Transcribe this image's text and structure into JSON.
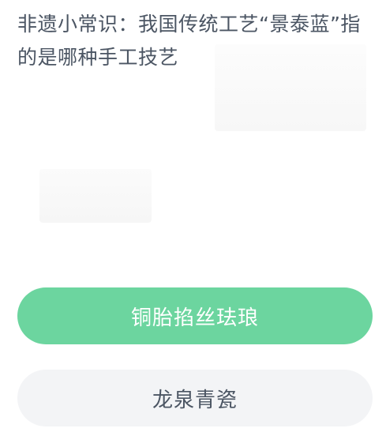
{
  "question": {
    "text": "非遗小常识：我国传统工艺“景泰蓝”指的是哪种手工技艺"
  },
  "options": [
    {
      "label": "铜胎掐丝珐琅",
      "state": "selected"
    },
    {
      "label": "龙泉青瓷",
      "state": "normal"
    }
  ],
  "colors": {
    "selected_bg": "#6cd59f",
    "normal_bg": "#f3f4f6",
    "text": "#4b5563"
  }
}
